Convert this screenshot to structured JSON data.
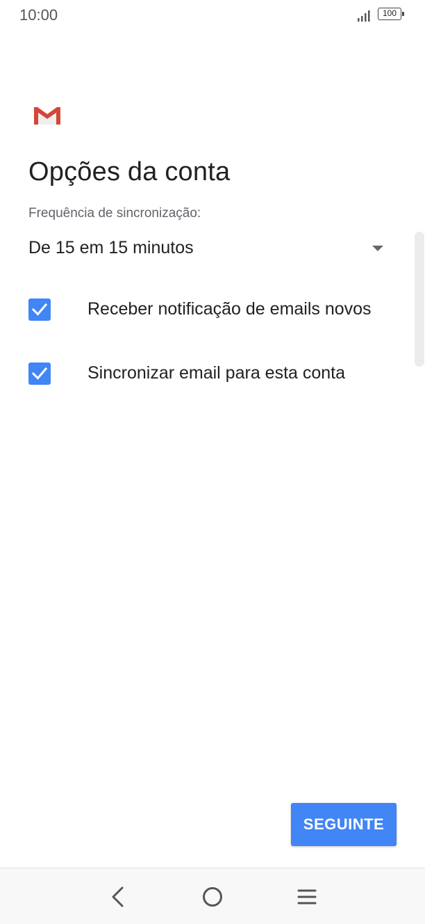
{
  "status_bar": {
    "time": "10:00",
    "battery": "100"
  },
  "icons": {
    "logo": "gmail-logo",
    "signal": "signal-icon",
    "battery": "battery-icon",
    "dropdown": "dropdown-arrow-icon",
    "checkbox": "checkmark-icon",
    "nav_back": "back-icon",
    "nav_home": "home-icon",
    "nav_menu": "menu-icon"
  },
  "main": {
    "title": "Opções da conta",
    "sync_label": "Frequência de sincronização:",
    "sync_value": "De 15 em 15 minutos",
    "options": [
      {
        "label": "Receber notificação de emails novos",
        "checked": true
      },
      {
        "label": "Sincronizar email para esta conta",
        "checked": true
      }
    ],
    "next_button": "SEGUINTE"
  },
  "colors": {
    "accent": "#4285f4",
    "gmail_red": "#d44638"
  }
}
